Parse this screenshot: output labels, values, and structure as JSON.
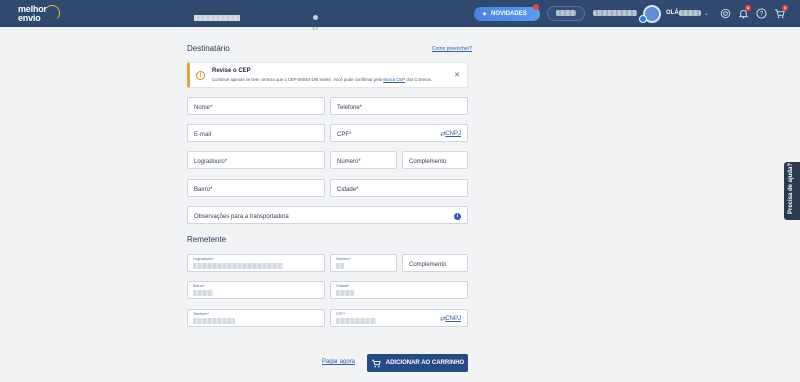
{
  "header": {
    "logo_line1": "melhor",
    "logo_line2": "envio",
    "novidades_label": "NOVIDADES",
    "greeting": "OLÁ,",
    "notifications_count": "1",
    "cart_count": "1",
    "colors": {
      "bar": "#2f4a6e",
      "accent": "#4a83e0",
      "badge": "#e5483d"
    },
    "icons": [
      "settings-icon",
      "bell-icon",
      "help-icon",
      "cart-icon"
    ]
  },
  "stepper": {
    "current_step": "3/4"
  },
  "destinatario": {
    "title": "Destinatário",
    "help_link": "Como preencher?",
    "alert": {
      "title": "Revise o CEP",
      "text_before": "Continue apenas se tiver certeza que o CEP 69040-195 existe. Você pode confirmar pela ",
      "link": "Busca CEP",
      "text_after": " dos Correios."
    },
    "fields": {
      "nome": "Nome*",
      "telefone": "Telefone*",
      "email": "E-mail",
      "cpf": "CPF*",
      "cnpj_toggle": "CNPJ",
      "logradouro": "Logradouro*",
      "numero": "Número*",
      "complemento": "Complemento",
      "bairro": "Bairro*",
      "cidade": "Cidade*",
      "observacoes": "Observações para a transportadora"
    }
  },
  "remetente": {
    "title": "Remetente",
    "fields": {
      "logradouro": "Logradouro*",
      "numero": "Número*",
      "complemento": "Complemento",
      "bairro": "Bairro*",
      "cidade": "Cidade*",
      "telefone": "Telefone*",
      "cpf": "CPF*",
      "cnpj_toggle": "CNPJ"
    }
  },
  "footer": {
    "pay_now": "Pagar agora",
    "add_to_cart": "ADICIONAR AO CARRINHO"
  },
  "help_tab": "Precisa de ajuda?"
}
